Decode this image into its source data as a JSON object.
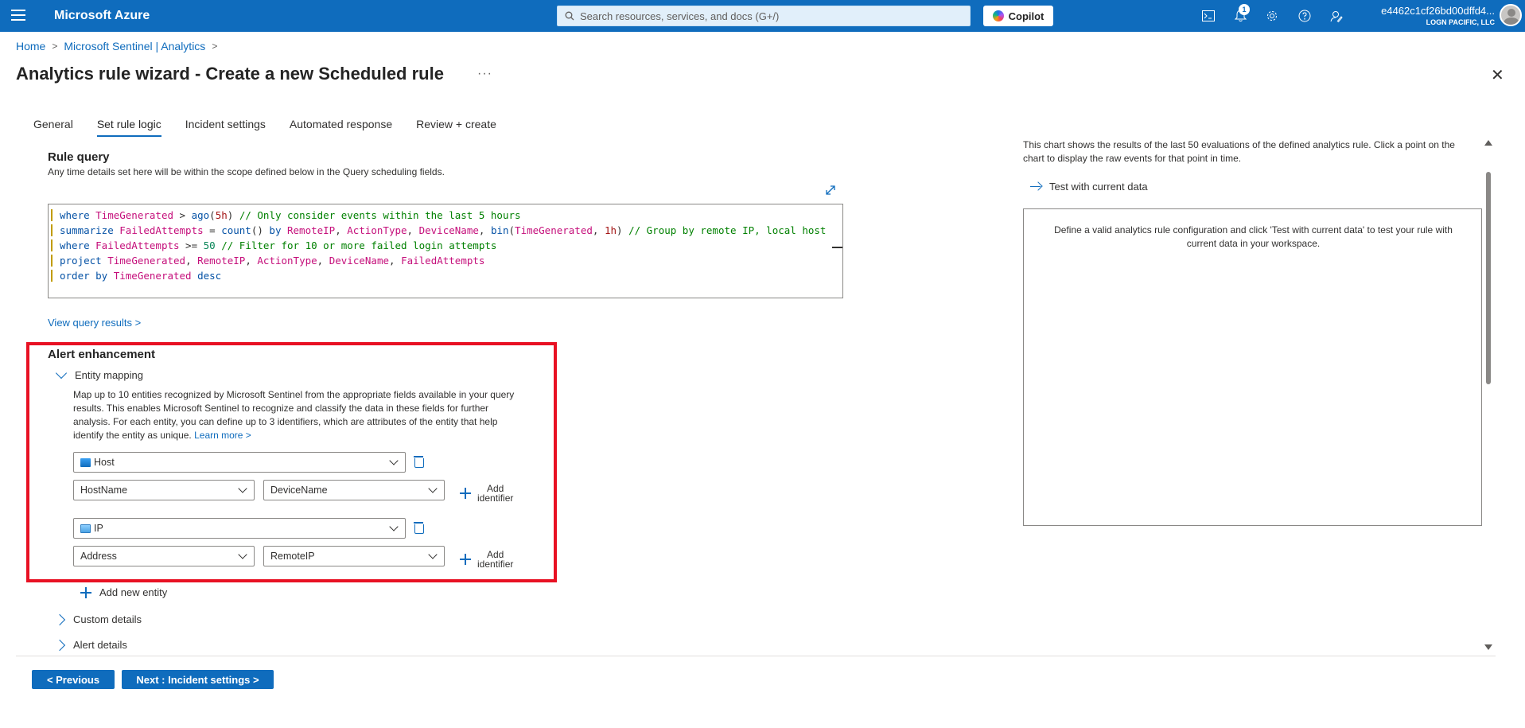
{
  "topbar": {
    "brand": "Microsoft Azure",
    "search_placeholder": "Search resources, services, and docs (G+/)",
    "copilot_label": "Copilot",
    "notification_count": "1",
    "account_name": "e4462c1cf26bd00dffd4...",
    "account_org": "LOGN PACIFIC, LLC"
  },
  "breadcrumb": {
    "home": "Home",
    "sentinel": "Microsoft Sentinel | Analytics"
  },
  "page": {
    "title": "Analytics rule wizard - Create a new Scheduled rule",
    "more": "···"
  },
  "tabs": [
    {
      "label": "General"
    },
    {
      "label": "Set rule logic"
    },
    {
      "label": "Incident settings"
    },
    {
      "label": "Automated response"
    },
    {
      "label": "Review + create"
    }
  ],
  "rule_query": {
    "title": "Rule query",
    "description": "Any time details set here will be within the scope defined below in the Query scheduling fields."
  },
  "view_query_results": "View query results >",
  "alert_enhancement": {
    "title": "Alert enhancement",
    "entity_mapping_label": "Entity mapping",
    "entity_mapping_desc": "Map up to 10 entities recognized by Microsoft Sentinel from the appropriate fields available in your query results. This enables Microsoft Sentinel to recognize and classify the data in these fields for further analysis. For each entity, you can define up to 3 identifiers, which are attributes of the entity that help identify the entity as unique.",
    "learn_more": "Learn more >",
    "entities": [
      {
        "type": "Host",
        "identifier": "HostName",
        "column": "DeviceName"
      },
      {
        "type": "IP",
        "identifier": "Address",
        "column": "RemoteIP"
      }
    ],
    "add_identifier_line1": "Add",
    "add_identifier_line2": "identifier",
    "add_new_entity": "Add new entity",
    "custom_details": "Custom details",
    "alert_details": "Alert details"
  },
  "footer": {
    "previous": "< Previous",
    "next": "Next : Incident settings >"
  },
  "right_panel": {
    "description": "This chart shows the results of the last 50 evaluations of the defined analytics rule. Click a point on the chart to display the raw events for that point in time.",
    "test_label": "Test with current data",
    "box_text": "Define a valid analytics rule configuration and click 'Test with current data' to test your rule with current data in your workspace."
  }
}
